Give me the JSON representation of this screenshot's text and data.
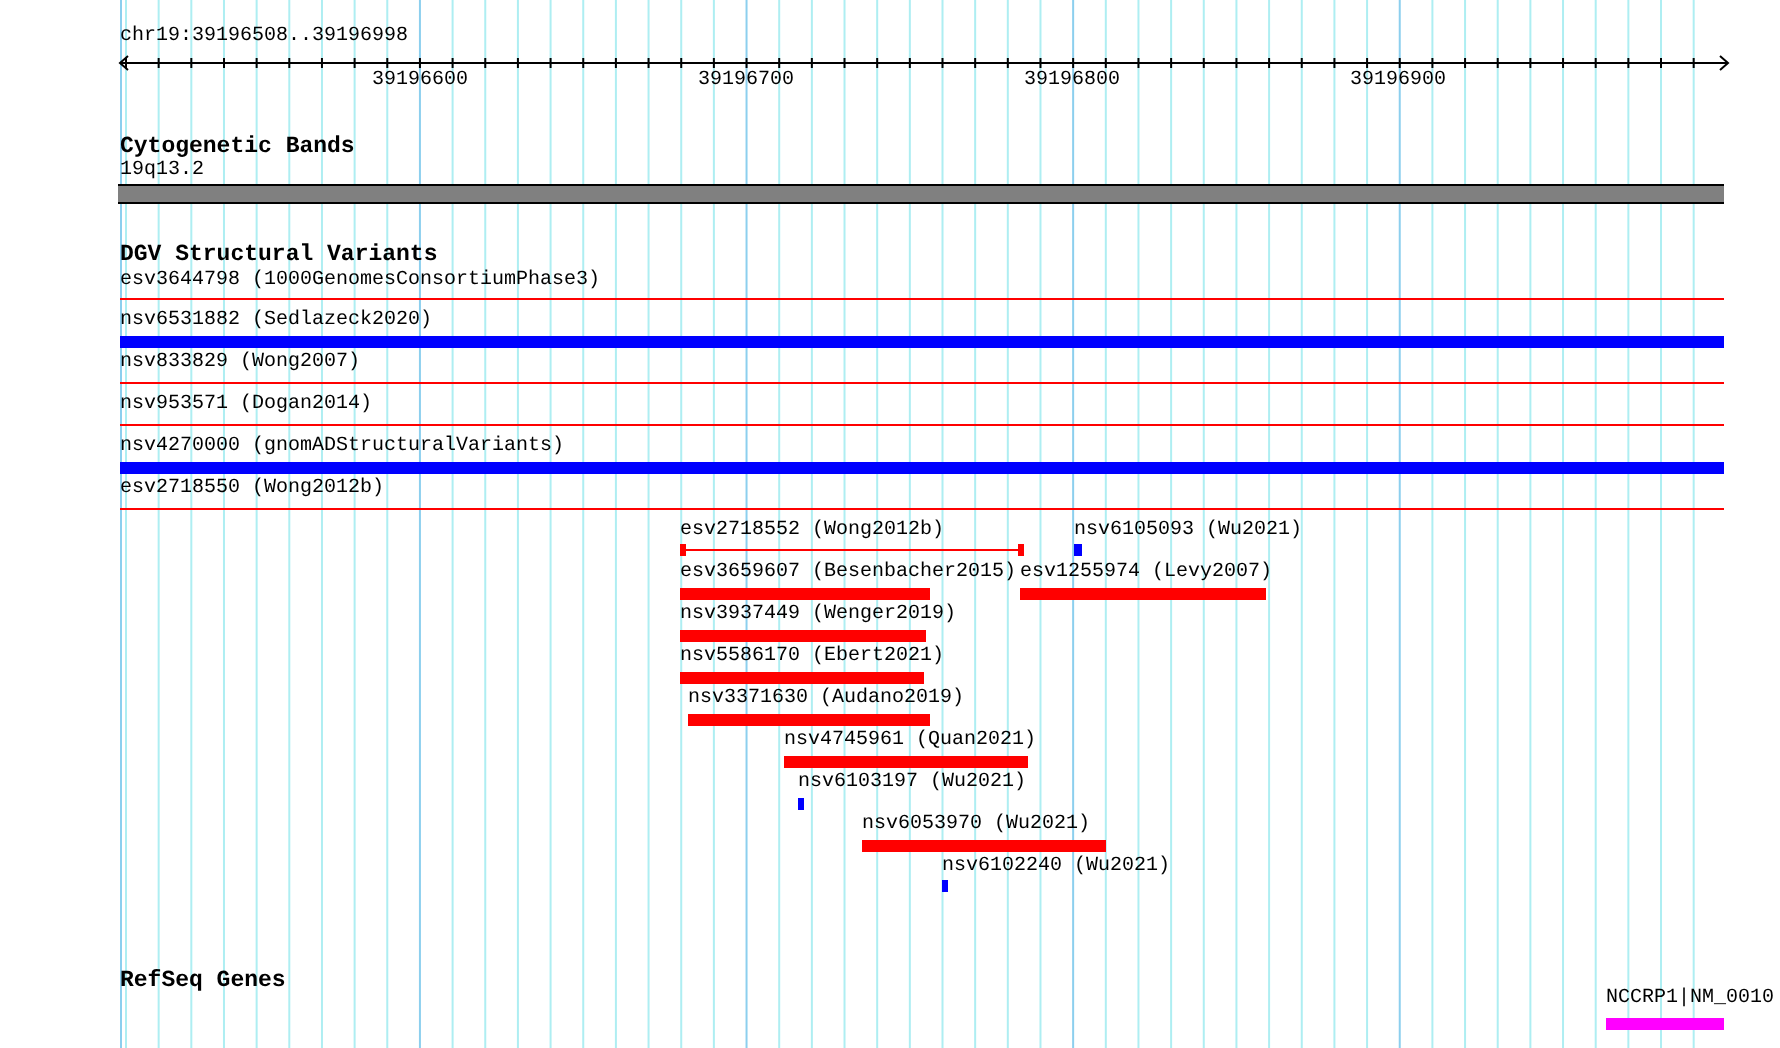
{
  "ruler": {
    "location": "chr19:39196508..39196998",
    "ticks": [
      "39196600",
      "39196700",
      "39196800",
      "39196900"
    ]
  },
  "tracks": [
    {
      "title": "Cytogenetic Bands",
      "features": [
        {
          "label": "19q13.2",
          "kind": "band",
          "color": "#808080"
        }
      ]
    },
    {
      "title": "DGV Structural Variants",
      "features": [
        {
          "label": "esv3644798 (1000GenomesConsortiumPhase3)",
          "kind": "line",
          "color": "#ff0000"
        },
        {
          "label": "nsv6531882 (Sedlazeck2020)",
          "kind": "bar",
          "color": "#0000ff"
        },
        {
          "label": "nsv833829 (Wong2007)",
          "kind": "line",
          "color": "#ff0000"
        },
        {
          "label": "nsv953571 (Dogan2014)",
          "kind": "line",
          "color": "#ff0000"
        },
        {
          "label": "nsv4270000 (gnomADStructuralVariants)",
          "kind": "bar",
          "color": "#0000ff"
        },
        {
          "label": "esv2718550 (Wong2012b)",
          "kind": "line",
          "color": "#ff0000"
        },
        {
          "label": "esv2718552 (Wong2012b)",
          "kind": "span",
          "color": "#ff0000"
        },
        {
          "label": "nsv6105093 (Wu2021)",
          "kind": "bar",
          "color": "#0000ff"
        },
        {
          "label": "esv3659607 (Besenbacher2015)",
          "kind": "bar",
          "color": "#ff0000"
        },
        {
          "label": "esv1255974 (Levy2007)",
          "kind": "bar",
          "color": "#ff0000"
        },
        {
          "label": "nsv3937449 (Wenger2019)",
          "kind": "bar",
          "color": "#ff0000"
        },
        {
          "label": "nsv5586170 (Ebert2021)",
          "kind": "bar",
          "color": "#ff0000"
        },
        {
          "label": "nsv3371630 (Audano2019)",
          "kind": "bar",
          "color": "#ff0000"
        },
        {
          "label": "nsv4745961 (Quan2021)",
          "kind": "bar",
          "color": "#ff0000"
        },
        {
          "label": "nsv6103197 (Wu2021)",
          "kind": "bar",
          "color": "#0000ff"
        },
        {
          "label": "nsv6053970 (Wu2021)",
          "kind": "bar",
          "color": "#ff0000"
        },
        {
          "label": "nsv6102240 (Wu2021)",
          "kind": "bar",
          "color": "#0000ff"
        }
      ]
    },
    {
      "title": "RefSeq Genes",
      "features": [
        {
          "label": "NCCRP1|NM_0010",
          "kind": "bar",
          "color": "#ff00ff"
        }
      ]
    }
  ]
}
